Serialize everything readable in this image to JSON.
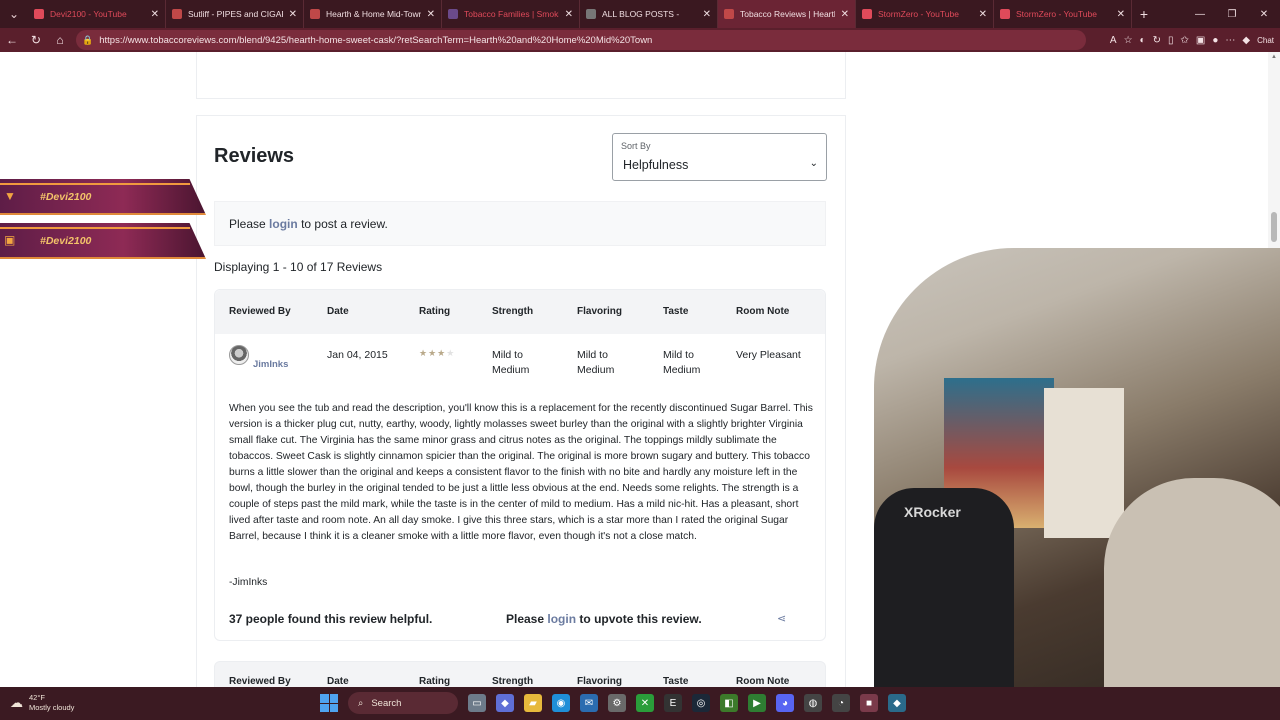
{
  "browser": {
    "tabs": [
      {
        "label": "Devi2100 - YouTube",
        "color": "#e04a5a",
        "yt": true
      },
      {
        "label": "Sutliff - PIPES and CIGARS",
        "color": "#c04848",
        "yt": false
      },
      {
        "label": "Hearth & Home Mid-Town S",
        "color": "#c04848",
        "yt": false
      },
      {
        "label": "Tobacco Families | Smoking",
        "color": "#6b4a8a",
        "yt": true
      },
      {
        "label": "ALL BLOG POSTS -",
        "color": "#777777",
        "yt": false
      },
      {
        "label": "Tobacco Reviews | Hearth &",
        "color": "#c04848",
        "yt": false,
        "active": true
      },
      {
        "label": "StormZero - YouTube",
        "color": "#e04a5a",
        "yt": true
      },
      {
        "label": "StormZero - YouTube",
        "color": "#e04a5a",
        "yt": true
      }
    ],
    "url": "https://www.tobaccoreviews.com/blend/9425/hearth-home-sweet-cask/?retSearchTerm=Hearth%20and%20Home%20Mid%20Town",
    "chat_label": "Chat"
  },
  "reviews": {
    "title": "Reviews",
    "sort_label": "Sort By",
    "sort_value": "Helpfulness",
    "please": "Please",
    "login": "login",
    "to_post": "to post a review.",
    "displaying": "Displaying 1 - 10 of 17 Reviews",
    "columns": [
      "Reviewed By",
      "Date",
      "Rating",
      "Strength",
      "Flavoring",
      "Taste",
      "Room Note"
    ],
    "review1": {
      "reviewer": "JimInks",
      "date": "Jan 04, 2015",
      "rating_stars": 3,
      "strength": "Mild to Medium",
      "flavoring": "Mild to Medium",
      "taste": "Mild to Medium",
      "room_note": "Very Pleasant",
      "body": "When you see the tub and read the description, you'll know this is a replacement for the recently discontinued Sugar Barrel. This version is a thicker plug cut, nutty, earthy, woody, lightly molasses sweet burley than the original with a slightly brighter Virginia small flake cut. The Virginia has the same minor grass and citrus notes as the original. The toppings mildly sublimate the tobaccos. Sweet Cask is slightly cinnamon spicier than the original. The original is more brown sugary and buttery. This tobacco burns a little slower than the original and keeps a consistent flavor to the finish with no bite and hardly any moisture left in the bowl, though the burley in the original tended to be just a little less obvious at the end. Needs some relights. The strength is a couple of steps past the mild mark, while the taste is in the center of mild to medium. Has a mild nic-hit. Has a pleasant, short lived after taste and room note. An all day smoke. I give this three stars, which is a star more than I rated the original Sugar Barrel, because I think it is a cleaner smoke with a little more flavor, even though it's not a close match.",
      "signature": "-JimInks",
      "helpful": "37 people found this review helpful.",
      "upvote_pre": "Please",
      "upvote_post": "to upvote this review."
    }
  },
  "overlay": {
    "banner_text": "#Devi2100",
    "chair_brand": "XRocker"
  },
  "taskbar": {
    "temp": "42°F",
    "weather": "Mostly cloudy",
    "search": "Search"
  }
}
